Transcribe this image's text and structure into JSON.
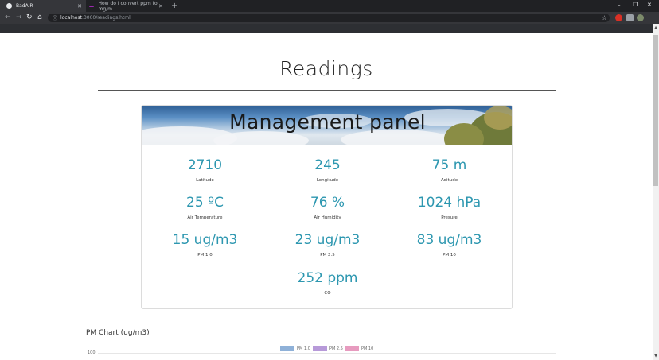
{
  "browser": {
    "tabs": [
      {
        "title": "BadAiR",
        "active": true
      },
      {
        "title": "How do I convert ppm to mg/m",
        "active": false
      }
    ],
    "url": {
      "host": "localhost",
      "path": ":3000/readings.html"
    }
  },
  "page": {
    "title": "Readings",
    "panel_title": "Management panel",
    "metrics": [
      {
        "value": "2710",
        "label": "Latitude"
      },
      {
        "value": "245",
        "label": "Longitude"
      },
      {
        "value": "75 m",
        "label": "Aditude"
      },
      {
        "value": "25 ºC",
        "label": "Air Temperature"
      },
      {
        "value": "76 %",
        "label": "Air Humidity"
      },
      {
        "value": "1024 hPa",
        "label": "Presure"
      },
      {
        "value": "15 ug/m3",
        "label": "PM 1.0"
      },
      {
        "value": "23 ug/m3",
        "label": "PM 2.5"
      },
      {
        "value": "83 ug/m3",
        "label": "PM 10"
      },
      {
        "value": "252 ppm",
        "label": "CO"
      }
    ],
    "chart": {
      "title": "PM Chart (ug/m3)",
      "legend": [
        {
          "name": "PM 1.0",
          "color": "#8fb1d8"
        },
        {
          "name": "PM 2.5",
          "color": "#b79ad9"
        },
        {
          "name": "PM 10",
          "color": "#e79bbf"
        }
      ],
      "ytick_top": "100"
    }
  }
}
